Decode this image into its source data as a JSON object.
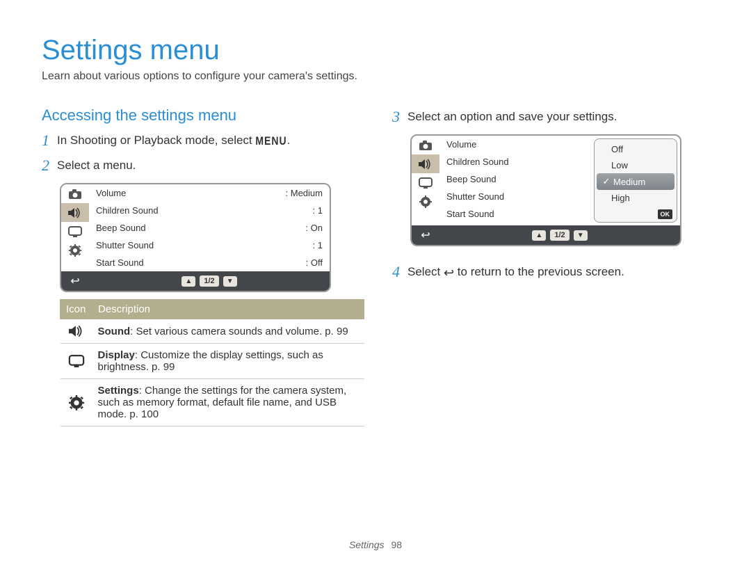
{
  "title": "Settings menu",
  "subtitle": "Learn about various options to configure your camera's settings.",
  "section_heading": "Accessing the settings menu",
  "steps": {
    "s1": {
      "num": "1",
      "prefix": "In Shooting or Playback mode, select ",
      "menu_label": "MENU",
      "suffix": "."
    },
    "s2": {
      "num": "2",
      "text": "Select a menu."
    },
    "s3": {
      "num": "3",
      "text": "Select an option and save your settings."
    },
    "s4": {
      "num": "4",
      "prefix": "Select ",
      "suffix": " to return to the previous screen."
    }
  },
  "screen1": {
    "rows": [
      {
        "label": "Volume",
        "value": "Medium"
      },
      {
        "label": "Children Sound",
        "value": "1"
      },
      {
        "label": "Beep Sound",
        "value": "On"
      },
      {
        "label": "Shutter Sound",
        "value": "1"
      },
      {
        "label": "Start Sound",
        "value": "Off"
      }
    ],
    "pager": "1/2"
  },
  "screen2": {
    "rows": [
      {
        "label": "Volume"
      },
      {
        "label": "Children Sound"
      },
      {
        "label": "Beep Sound"
      },
      {
        "label": "Shutter Sound"
      },
      {
        "label": "Start Sound"
      }
    ],
    "options": [
      {
        "label": "Off"
      },
      {
        "label": "Low"
      },
      {
        "label": "Medium",
        "selected": true
      },
      {
        "label": "High"
      }
    ],
    "ok": "OK",
    "pager": "1/2"
  },
  "desc_table": {
    "head_icon": "Icon",
    "head_desc": "Description",
    "rows": [
      {
        "icon": "sound",
        "title": "Sound",
        "text": ": Set various camera sounds and volume. p. 99"
      },
      {
        "icon": "display",
        "title": "Display",
        "text": ": Customize the display settings, such as brightness. p. 99"
      },
      {
        "icon": "settings",
        "title": "Settings",
        "text": ": Change the settings for the camera system, such as memory format, default file name, and USB mode. p. 100"
      }
    ]
  },
  "footer": {
    "section": "Settings",
    "page": "98"
  }
}
